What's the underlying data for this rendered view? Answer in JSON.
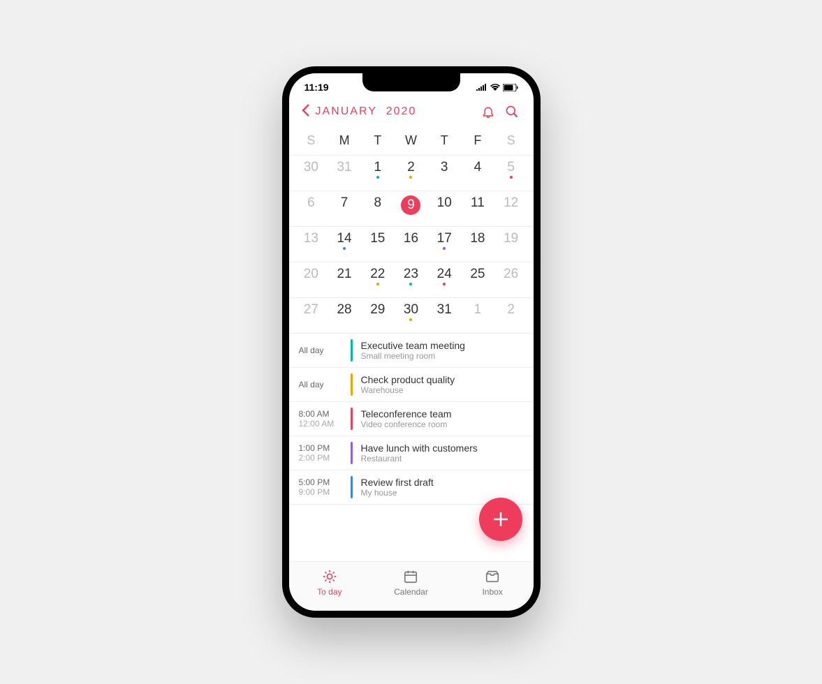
{
  "status": {
    "time": "11:19"
  },
  "header": {
    "month": "JANUARY",
    "year": "2020"
  },
  "weekdays": [
    "S",
    "M",
    "T",
    "W",
    "T",
    "F",
    "S"
  ],
  "calendar": [
    [
      {
        "n": "30",
        "faded": true
      },
      {
        "n": "31",
        "faded": true
      },
      {
        "n": "1",
        "dot": "#00b8a9"
      },
      {
        "n": "2",
        "dot": "#f0a500"
      },
      {
        "n": "3"
      },
      {
        "n": "4"
      },
      {
        "n": "5",
        "faded": true,
        "dot": "#ef3c5c"
      }
    ],
    [
      {
        "n": "6",
        "faded": true
      },
      {
        "n": "7"
      },
      {
        "n": "8"
      },
      {
        "n": "9",
        "selected": true
      },
      {
        "n": "10"
      },
      {
        "n": "11"
      },
      {
        "n": "12",
        "faded": true
      }
    ],
    [
      {
        "n": "13",
        "faded": true
      },
      {
        "n": "14",
        "dot": "#3b82f6"
      },
      {
        "n": "15"
      },
      {
        "n": "16"
      },
      {
        "n": "17",
        "dot": "#8b5cf6"
      },
      {
        "n": "18"
      },
      {
        "n": "19",
        "faded": true
      }
    ],
    [
      {
        "n": "20",
        "faded": true
      },
      {
        "n": "21"
      },
      {
        "n": "22",
        "dot": "#f0a500"
      },
      {
        "n": "23",
        "dot": "#00b8a9"
      },
      {
        "n": "24",
        "dot": "#ef3c5c"
      },
      {
        "n": "25"
      },
      {
        "n": "26",
        "faded": true
      }
    ],
    [
      {
        "n": "27",
        "faded": true
      },
      {
        "n": "28"
      },
      {
        "n": "29"
      },
      {
        "n": "30",
        "dot": "#f0a500"
      },
      {
        "n": "31"
      },
      {
        "n": "1",
        "faded": true
      },
      {
        "n": "2",
        "faded": true
      }
    ]
  ],
  "events": [
    {
      "time1": "All day",
      "time2": "",
      "color": "#00b8a9",
      "title": "Executive team meeting",
      "loc": "Small meeting room"
    },
    {
      "time1": "All day",
      "time2": "",
      "color": "#f0a500",
      "title": "Check product quality",
      "loc": "Warehouse"
    },
    {
      "time1": "8:00 AM",
      "time2": "12:00 AM",
      "color": "#ef3c5c",
      "title": "Teleconference team",
      "loc": "Video conference room"
    },
    {
      "time1": "1:00 PM",
      "time2": "2:00 PM",
      "color": "#8b5cf6",
      "title": "Have lunch with customers",
      "loc": "Restaurant"
    },
    {
      "time1": "5:00 PM",
      "time2": "9:00 PM",
      "color": "#3b82f6",
      "title": "Review first draft",
      "loc": "My house"
    }
  ],
  "tabs": [
    {
      "label": "To day",
      "active": true
    },
    {
      "label": "Calendar",
      "active": false
    },
    {
      "label": "Inbox",
      "active": false
    }
  ]
}
